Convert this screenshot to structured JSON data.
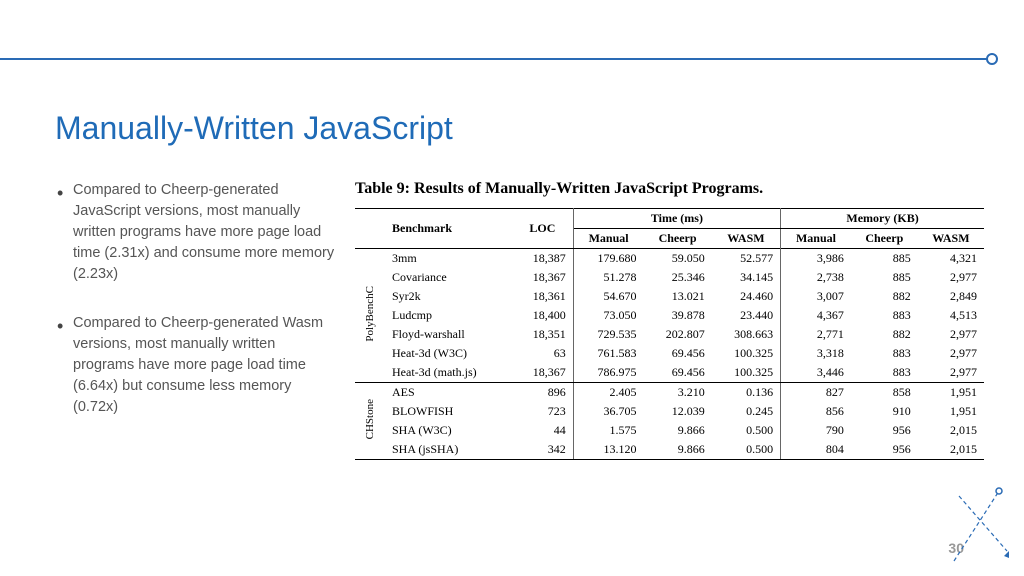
{
  "title": "Manually-Written JavaScript",
  "pageNumber": "30",
  "bullets": [
    "Compared to Cheerp-generated JavaScript versions, most manually written programs have more page load time (2.31x) and consume more memory (2.23x)",
    "Compared to Cheerp-generated Wasm versions, most manually written programs have more page load time (6.64x) but consume less memory (0.72x)"
  ],
  "tableCaption": "Table 9: Results of Manually-Written JavaScript Programs.",
  "headers": {
    "benchmark": "Benchmark",
    "loc": "LOC",
    "time": "Time (ms)",
    "memory": "Memory (KB)",
    "manual": "Manual",
    "cheerp": "Cheerp",
    "wasm": "WASM"
  },
  "groups": [
    {
      "name": "PolyBenchC",
      "rows": [
        {
          "b": "3mm",
          "loc": "18,387",
          "tm": "179.680",
          "tc": "59.050",
          "tw": "52.577",
          "mm": "3,986",
          "mc": "885",
          "mw": "4,321"
        },
        {
          "b": "Covariance",
          "loc": "18,367",
          "tm": "51.278",
          "tc": "25.346",
          "tw": "34.145",
          "mm": "2,738",
          "mc": "885",
          "mw": "2,977"
        },
        {
          "b": "Syr2k",
          "loc": "18,361",
          "tm": "54.670",
          "tc": "13.021",
          "tw": "24.460",
          "mm": "3,007",
          "mc": "882",
          "mw": "2,849"
        },
        {
          "b": "Ludcmp",
          "loc": "18,400",
          "tm": "73.050",
          "tc": "39.878",
          "tw": "23.440",
          "mm": "4,367",
          "mc": "883",
          "mw": "4,513"
        },
        {
          "b": "Floyd-warshall",
          "loc": "18,351",
          "tm": "729.535",
          "tc": "202.807",
          "tw": "308.663",
          "mm": "2,771",
          "mc": "882",
          "mw": "2,977"
        },
        {
          "b": "Heat-3d (W3C)",
          "loc": "63",
          "tm": "761.583",
          "tc": "69.456",
          "tw": "100.325",
          "mm": "3,318",
          "mc": "883",
          "mw": "2,977"
        },
        {
          "b": "Heat-3d (math.js)",
          "loc": "18,367",
          "tm": "786.975",
          "tc": "69.456",
          "tw": "100.325",
          "mm": "3,446",
          "mc": "883",
          "mw": "2,977"
        }
      ]
    },
    {
      "name": "CHStone",
      "rows": [
        {
          "b": "AES",
          "loc": "896",
          "tm": "2.405",
          "tc": "3.210",
          "tw": "0.136",
          "mm": "827",
          "mc": "858",
          "mw": "1,951"
        },
        {
          "b": "BLOWFISH",
          "loc": "723",
          "tm": "36.705",
          "tc": "12.039",
          "tw": "0.245",
          "mm": "856",
          "mc": "910",
          "mw": "1,951"
        },
        {
          "b": "SHA (W3C)",
          "loc": "44",
          "tm": "1.575",
          "tc": "9.866",
          "tw": "0.500",
          "mm": "790",
          "mc": "956",
          "mw": "2,015"
        },
        {
          "b": "SHA (jsSHA)",
          "loc": "342",
          "tm": "13.120",
          "tc": "9.866",
          "tw": "0.500",
          "mm": "804",
          "mc": "956",
          "mw": "2,015"
        }
      ]
    }
  ]
}
